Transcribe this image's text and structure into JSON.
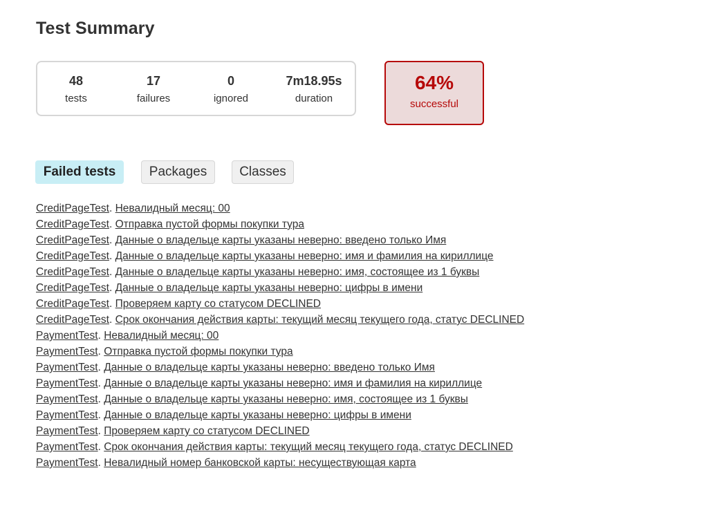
{
  "title": "Test Summary",
  "summary": {
    "tests": {
      "value": "48",
      "label": "tests"
    },
    "failures": {
      "value": "17",
      "label": "failures"
    },
    "ignored": {
      "value": "0",
      "label": "ignored"
    },
    "duration": {
      "value": "7m18.95s",
      "label": "duration"
    }
  },
  "success_rate": {
    "value": "64%",
    "label": "successful"
  },
  "tabs": {
    "failed": "Failed tests",
    "packages": "Packages",
    "classes": "Classes"
  },
  "colors": {
    "failure_red": "#b60808",
    "failure_bg": "#ecdada",
    "active_tab_bg": "#c8eef5"
  },
  "failed_tests": [
    {
      "class": "CreditPageTest",
      "name": "Невалидный месяц: 00"
    },
    {
      "class": "CreditPageTest",
      "name": "Отправка пустой формы покупки тура"
    },
    {
      "class": "CreditPageTest",
      "name": "Данные о владельце карты указаны неверно: введено только Имя"
    },
    {
      "class": "CreditPageTest",
      "name": "Данные о владельце карты указаны неверно: имя и фамилия на кириллице"
    },
    {
      "class": "CreditPageTest",
      "name": "Данные о владельце карты указаны неверно: имя, состоящее из 1 буквы"
    },
    {
      "class": "CreditPageTest",
      "name": "Данные о владельце карты указаны неверно: цифры в имени"
    },
    {
      "class": "CreditPageTest",
      "name": "Проверяем карту со статусом DECLINED"
    },
    {
      "class": "CreditPageTest",
      "name": "Срок окончания действия карты: текущий месяц текущего года, статус DECLINED"
    },
    {
      "class": "PaymentTest",
      "name": "Невалидный месяц: 00"
    },
    {
      "class": "PaymentTest",
      "name": "Отправка пустой формы покупки тура"
    },
    {
      "class": "PaymentTest",
      "name": "Данные о владельце карты указаны неверно: введено только Имя"
    },
    {
      "class": "PaymentTest",
      "name": "Данные о владельце карты указаны неверно: имя и фамилия на кириллице"
    },
    {
      "class": "PaymentTest",
      "name": "Данные о владельце карты указаны неверно: имя, состоящее из 1 буквы"
    },
    {
      "class": "PaymentTest",
      "name": "Данные о владельце карты указаны неверно: цифры в имени"
    },
    {
      "class": "PaymentTest",
      "name": "Проверяем карту со статусом DECLINED"
    },
    {
      "class": "PaymentTest",
      "name": "Срок окончания действия карты: текущий месяц текущего года, статус DECLINED"
    },
    {
      "class": "PaymentTest",
      "name": "Невалидный номер банковской карты: несуществующая карта"
    }
  ]
}
